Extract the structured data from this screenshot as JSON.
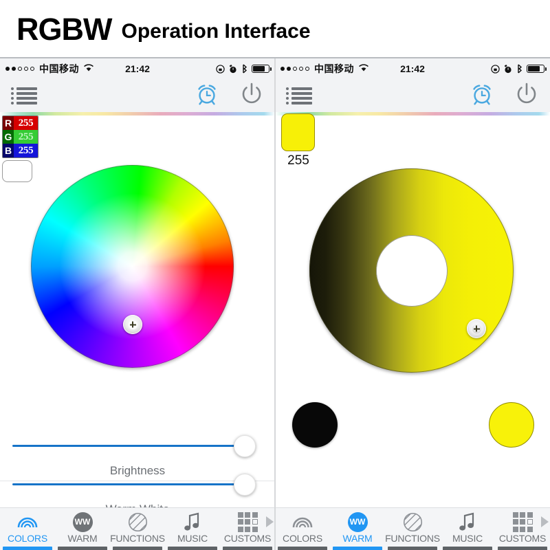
{
  "title": {
    "primary": "RGBW",
    "secondary": "Operation Interface"
  },
  "status_bar": {
    "carrier": "中国移动",
    "time": "21:42",
    "signal_dots_filled": 2,
    "signal_dots_total": 5,
    "icons": [
      "wifi-icon",
      "rotation-lock-icon",
      "alarm-icon",
      "bluetooth-icon",
      "battery-icon"
    ]
  },
  "toolbar": {
    "menu_icon": "list-menu-icon",
    "timer_icon": "alarm-clock-icon",
    "power_icon": "power-icon"
  },
  "left_panel": {
    "rgb_readout": [
      {
        "channel": "R",
        "value": "255",
        "bg": "#d60000"
      },
      {
        "channel": "G",
        "value": "255",
        "bg": "#35cc35"
      },
      {
        "channel": "B",
        "value": "255",
        "bg": "#1515d9"
      }
    ],
    "preview_swatch_color": "#ffffff",
    "color_wheel": {
      "name": "hsv-color-wheel",
      "selection": "center-white"
    },
    "sliders": [
      {
        "label": "Brightness",
        "value": 100,
        "track_color": "#1673c8"
      },
      {
        "label": "Warm White",
        "value": 100,
        "track_color": "#1673c8"
      }
    ]
  },
  "right_panel": {
    "preview_swatch_color": "#f7f007",
    "preview_value": "255",
    "warm_wheel": {
      "name": "warm-white-wheel",
      "selection": "right-max"
    },
    "endpoints": [
      {
        "name": "minimum-black-circle",
        "color": "#080808"
      },
      {
        "name": "maximum-yellow-circle",
        "color": "#f8f209"
      }
    ]
  },
  "tabs_left": [
    {
      "label": "COLORS",
      "icon": "rainbow-icon",
      "active": true
    },
    {
      "label": "WARM",
      "icon": "ww-circle-icon",
      "active": false
    },
    {
      "label": "FUNCTIONS",
      "icon": "hatched-circle-icon",
      "active": false
    },
    {
      "label": "MUSIC",
      "icon": "music-note-icon",
      "active": false
    },
    {
      "label": "CUSTOMS",
      "icon": "grid-icon",
      "active": false
    }
  ],
  "tabs_right": [
    {
      "label": "COLORS",
      "icon": "rainbow-icon",
      "active": false
    },
    {
      "label": "WARM",
      "icon": "ww-circle-icon",
      "active": true
    },
    {
      "label": "FUNCTIONS",
      "icon": "hatched-circle-icon",
      "active": false
    },
    {
      "label": "MUSIC",
      "icon": "music-note-icon",
      "active": false
    },
    {
      "label": "CUSTOMS",
      "icon": "grid-icon",
      "active": false
    }
  ],
  "colors": {
    "accent": "#2196f3",
    "slider": "#1673c8",
    "inactive": "#6d7175"
  }
}
